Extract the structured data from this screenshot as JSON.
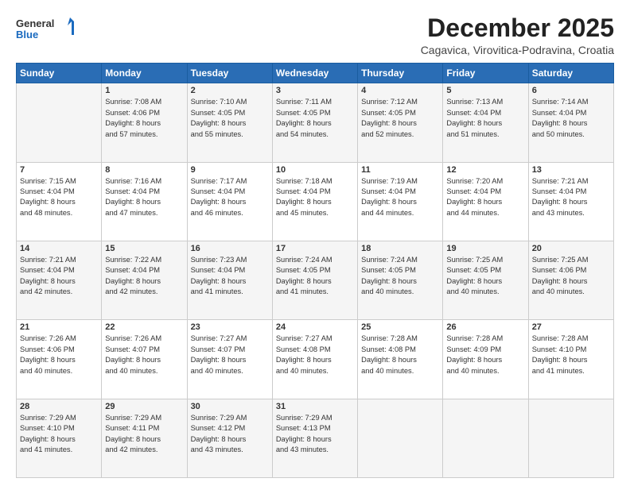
{
  "header": {
    "logo_line1": "General",
    "logo_line2": "Blue",
    "month": "December 2025",
    "location": "Cagavica, Virovitica-Podravina, Croatia"
  },
  "weekdays": [
    "Sunday",
    "Monday",
    "Tuesday",
    "Wednesday",
    "Thursday",
    "Friday",
    "Saturday"
  ],
  "weeks": [
    [
      {
        "day": "",
        "info": ""
      },
      {
        "day": "1",
        "info": "Sunrise: 7:08 AM\nSunset: 4:06 PM\nDaylight: 8 hours\nand 57 minutes."
      },
      {
        "day": "2",
        "info": "Sunrise: 7:10 AM\nSunset: 4:05 PM\nDaylight: 8 hours\nand 55 minutes."
      },
      {
        "day": "3",
        "info": "Sunrise: 7:11 AM\nSunset: 4:05 PM\nDaylight: 8 hours\nand 54 minutes."
      },
      {
        "day": "4",
        "info": "Sunrise: 7:12 AM\nSunset: 4:05 PM\nDaylight: 8 hours\nand 52 minutes."
      },
      {
        "day": "5",
        "info": "Sunrise: 7:13 AM\nSunset: 4:04 PM\nDaylight: 8 hours\nand 51 minutes."
      },
      {
        "day": "6",
        "info": "Sunrise: 7:14 AM\nSunset: 4:04 PM\nDaylight: 8 hours\nand 50 minutes."
      }
    ],
    [
      {
        "day": "7",
        "info": "Sunrise: 7:15 AM\nSunset: 4:04 PM\nDaylight: 8 hours\nand 48 minutes."
      },
      {
        "day": "8",
        "info": "Sunrise: 7:16 AM\nSunset: 4:04 PM\nDaylight: 8 hours\nand 47 minutes."
      },
      {
        "day": "9",
        "info": "Sunrise: 7:17 AM\nSunset: 4:04 PM\nDaylight: 8 hours\nand 46 minutes."
      },
      {
        "day": "10",
        "info": "Sunrise: 7:18 AM\nSunset: 4:04 PM\nDaylight: 8 hours\nand 45 minutes."
      },
      {
        "day": "11",
        "info": "Sunrise: 7:19 AM\nSunset: 4:04 PM\nDaylight: 8 hours\nand 44 minutes."
      },
      {
        "day": "12",
        "info": "Sunrise: 7:20 AM\nSunset: 4:04 PM\nDaylight: 8 hours\nand 44 minutes."
      },
      {
        "day": "13",
        "info": "Sunrise: 7:21 AM\nSunset: 4:04 PM\nDaylight: 8 hours\nand 43 minutes."
      }
    ],
    [
      {
        "day": "14",
        "info": "Sunrise: 7:21 AM\nSunset: 4:04 PM\nDaylight: 8 hours\nand 42 minutes."
      },
      {
        "day": "15",
        "info": "Sunrise: 7:22 AM\nSunset: 4:04 PM\nDaylight: 8 hours\nand 42 minutes."
      },
      {
        "day": "16",
        "info": "Sunrise: 7:23 AM\nSunset: 4:04 PM\nDaylight: 8 hours\nand 41 minutes."
      },
      {
        "day": "17",
        "info": "Sunrise: 7:24 AM\nSunset: 4:05 PM\nDaylight: 8 hours\nand 41 minutes."
      },
      {
        "day": "18",
        "info": "Sunrise: 7:24 AM\nSunset: 4:05 PM\nDaylight: 8 hours\nand 40 minutes."
      },
      {
        "day": "19",
        "info": "Sunrise: 7:25 AM\nSunset: 4:05 PM\nDaylight: 8 hours\nand 40 minutes."
      },
      {
        "day": "20",
        "info": "Sunrise: 7:25 AM\nSunset: 4:06 PM\nDaylight: 8 hours\nand 40 minutes."
      }
    ],
    [
      {
        "day": "21",
        "info": "Sunrise: 7:26 AM\nSunset: 4:06 PM\nDaylight: 8 hours\nand 40 minutes."
      },
      {
        "day": "22",
        "info": "Sunrise: 7:26 AM\nSunset: 4:07 PM\nDaylight: 8 hours\nand 40 minutes."
      },
      {
        "day": "23",
        "info": "Sunrise: 7:27 AM\nSunset: 4:07 PM\nDaylight: 8 hours\nand 40 minutes."
      },
      {
        "day": "24",
        "info": "Sunrise: 7:27 AM\nSunset: 4:08 PM\nDaylight: 8 hours\nand 40 minutes."
      },
      {
        "day": "25",
        "info": "Sunrise: 7:28 AM\nSunset: 4:08 PM\nDaylight: 8 hours\nand 40 minutes."
      },
      {
        "day": "26",
        "info": "Sunrise: 7:28 AM\nSunset: 4:09 PM\nDaylight: 8 hours\nand 40 minutes."
      },
      {
        "day": "27",
        "info": "Sunrise: 7:28 AM\nSunset: 4:10 PM\nDaylight: 8 hours\nand 41 minutes."
      }
    ],
    [
      {
        "day": "28",
        "info": "Sunrise: 7:29 AM\nSunset: 4:10 PM\nDaylight: 8 hours\nand 41 minutes."
      },
      {
        "day": "29",
        "info": "Sunrise: 7:29 AM\nSunset: 4:11 PM\nDaylight: 8 hours\nand 42 minutes."
      },
      {
        "day": "30",
        "info": "Sunrise: 7:29 AM\nSunset: 4:12 PM\nDaylight: 8 hours\nand 43 minutes."
      },
      {
        "day": "31",
        "info": "Sunrise: 7:29 AM\nSunset: 4:13 PM\nDaylight: 8 hours\nand 43 minutes."
      },
      {
        "day": "",
        "info": ""
      },
      {
        "day": "",
        "info": ""
      },
      {
        "day": "",
        "info": ""
      }
    ]
  ]
}
